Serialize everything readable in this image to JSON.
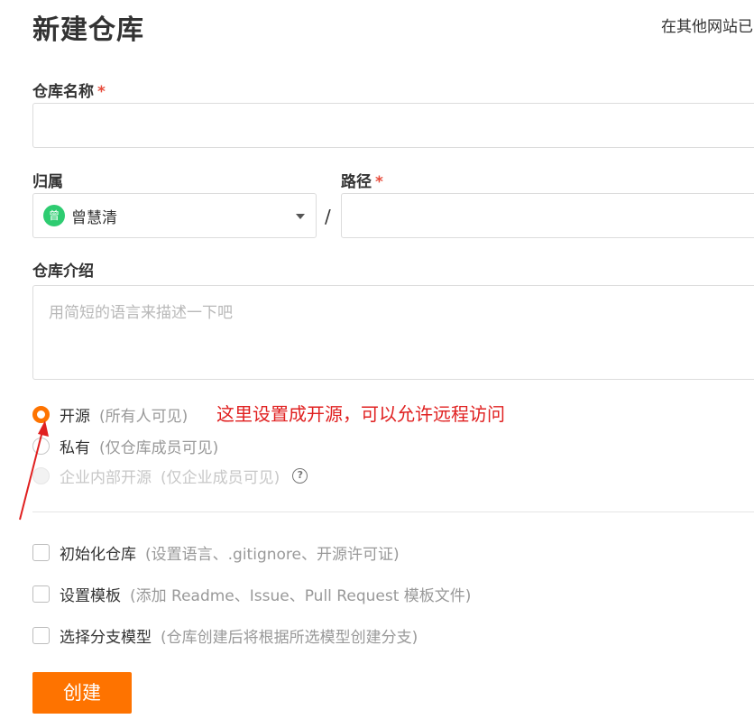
{
  "header": {
    "title": "新建仓库",
    "import_link": "在其他网站已"
  },
  "form": {
    "repo_name": {
      "label": "仓库名称",
      "required_mark": "*",
      "value": ""
    },
    "owner": {
      "label": "归属",
      "selected": "曾慧清",
      "avatar_text": "曾",
      "avatar_color": "#2ecc71"
    },
    "path_separator": "/",
    "path": {
      "label": "路径",
      "required_mark": "*",
      "value": ""
    },
    "description": {
      "label": "仓库介绍",
      "placeholder": "用简短的语言来描述一下吧"
    },
    "visibility": [
      {
        "label": "开源",
        "sub": "(所有人可见)",
        "checked": true,
        "disabled": false
      },
      {
        "label": "私有",
        "sub": "(仅仓库成员可见)",
        "checked": false,
        "disabled": false
      },
      {
        "label": "企业内部开源",
        "sub": "(仅企业成员可见)",
        "checked": false,
        "disabled": true
      }
    ],
    "options": [
      {
        "label": "初始化仓库",
        "sub": "(设置语言、.gitignore、开源许可证)",
        "checked": false
      },
      {
        "label": "设置模板",
        "sub": "(添加 Readme、Issue、Pull Request 模板文件)",
        "checked": false
      },
      {
        "label": "选择分支模型",
        "sub": "(仓库创建后将根据所选模型创建分支)",
        "checked": false
      }
    ],
    "submit_label": "创建"
  },
  "annotation": {
    "text": "这里设置成开源，可以允许远程访问",
    "color": "#e02020"
  },
  "colors": {
    "accent": "#fe7300"
  }
}
